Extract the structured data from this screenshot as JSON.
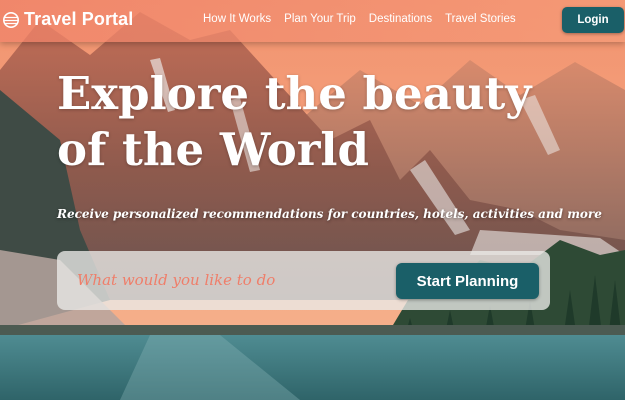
{
  "header": {
    "logo_text": "Travel Portal",
    "logo_icon": "globe-icon",
    "nav": [
      {
        "label": "How It Works"
      },
      {
        "label": "Plan Your Trip"
      },
      {
        "label": "Destinations"
      },
      {
        "label": "Travel Stories"
      }
    ],
    "login_label": "Login"
  },
  "hero": {
    "headline_line1": "Explore the beauty",
    "headline_line2": "of the World",
    "subtitle": "Receive personalized recommendations for countries, hotels, activities and more"
  },
  "search": {
    "placeholder": "What would you like to do",
    "value": "",
    "button_label": "Start Planning"
  },
  "colors": {
    "nav_bg": "#f08269",
    "accent": "#1a5f68",
    "placeholder": "#ef7e6a"
  }
}
